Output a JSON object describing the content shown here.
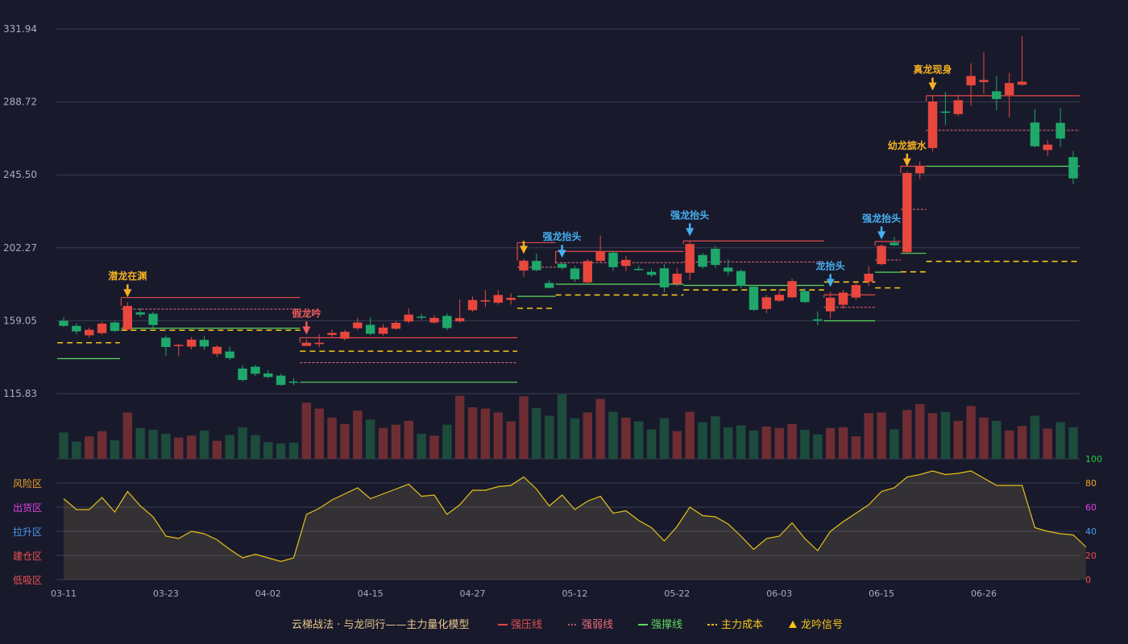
{
  "colors": {
    "up": "#e8473d",
    "down": "#1fa86a",
    "vol_up": "#6e2d33",
    "vol_down": "#1d4b3c",
    "pressure": "#e04848",
    "weak": "#f06a7a",
    "support": "#5fd85f",
    "cost": "#f5c518",
    "signal_yellow": "#f5b021",
    "signal_blue": "#45b0f0",
    "signal_red": "#f05a5a",
    "grid": "#3a3d52",
    "axis_text": "#a8acc0"
  },
  "legend": {
    "title": "云梯战法 · 与龙同行——主力量化模型",
    "pressure": "强压线",
    "weak": "强弱线",
    "support": "强撑线",
    "cost": "主力成本",
    "signal": "龙吟信号"
  },
  "zones": [
    {
      "label": "风险区",
      "color": "#f0a020"
    },
    {
      "label": "出货区",
      "color": "#e040e0"
    },
    {
      "label": "拉升区",
      "color": "#4a9af0"
    },
    {
      "label": "建仓区",
      "color": "#f05050"
    },
    {
      "label": "低吸区",
      "color": "#f05050"
    }
  ],
  "chart_data": {
    "type": "candlestick",
    "price_axis": {
      "ticks": [
        "331.94",
        "288.72",
        "245.50",
        "202.27",
        "159.05",
        "115.83"
      ]
    },
    "indicator_axis": {
      "ticks": [
        "100",
        "80",
        "60",
        "40",
        "20",
        "0"
      ],
      "tick_colors": [
        "#22cc44",
        "#f0a020",
        "#e040e0",
        "#4a9af0",
        "#f05050",
        "#f05050"
      ]
    },
    "date_labels": [
      {
        "i": 0,
        "label": "03-11"
      },
      {
        "i": 8,
        "label": "03-23"
      },
      {
        "i": 16,
        "label": "04-02"
      },
      {
        "i": 24,
        "label": "04-15"
      },
      {
        "i": 32,
        "label": "04-27"
      },
      {
        "i": 40,
        "label": "05-12"
      },
      {
        "i": 48,
        "label": "05-22"
      },
      {
        "i": 56,
        "label": "06-03"
      },
      {
        "i": 64,
        "label": "06-15"
      },
      {
        "i": 72,
        "label": "06-26"
      }
    ],
    "candles": [
      [
        159.0,
        156.0,
        161.2,
        155.3
      ],
      [
        156.0,
        152.7,
        157.5,
        151.0
      ],
      [
        150.4,
        153.7,
        155.0,
        148.9
      ],
      [
        151.7,
        157.3,
        158.5,
        150.6
      ],
      [
        158.0,
        153.0,
        158.8,
        152.3
      ],
      [
        153.8,
        167.8,
        170.1,
        153.1
      ],
      [
        164.0,
        162.7,
        166.6,
        161.2
      ],
      [
        163.2,
        156.5,
        164.3,
        154.8
      ],
      [
        149.0,
        143.5,
        150.4,
        138.3
      ],
      [
        144.3,
        144.7,
        145.5,
        137.9
      ],
      [
        143.7,
        147.8,
        149.3,
        142.0
      ],
      [
        147.7,
        143.8,
        150.0,
        141.8
      ],
      [
        139.4,
        143.6,
        144.6,
        137.6
      ],
      [
        140.8,
        136.9,
        143.7,
        135.7
      ],
      [
        130.7,
        123.9,
        132.8,
        123.1
      ],
      [
        131.8,
        127.6,
        132.8,
        126.4
      ],
      [
        127.8,
        125.7,
        129.8,
        125.0
      ],
      [
        126.5,
        121.0,
        127.6,
        120.6
      ],
      [
        123.0,
        122.3,
        125.0,
        121.0
      ],
      [
        144.1,
        146.0,
        148.0,
        144.7
      ],
      [
        145.2,
        146.0,
        151.0,
        143.4
      ],
      [
        150.6,
        151.8,
        153.7,
        149.3
      ],
      [
        148.4,
        152.5,
        153.5,
        147.4
      ],
      [
        154.6,
        158.0,
        160.7,
        153.5
      ],
      [
        156.6,
        151.3,
        161.0,
        150.5
      ],
      [
        151.3,
        155.0,
        157.0,
        150.3
      ],
      [
        154.3,
        157.8,
        158.9,
        153.7
      ],
      [
        158.6,
        162.7,
        166.3,
        157.6
      ],
      [
        161.5,
        160.8,
        163.2,
        159.6
      ],
      [
        158.0,
        160.7,
        162.3,
        157.3
      ],
      [
        161.9,
        154.7,
        163.4,
        153.4
      ],
      [
        158.7,
        160.6,
        171.7,
        158.0
      ],
      [
        165.3,
        171.3,
        173.4,
        164.4
      ],
      [
        170.4,
        171.2,
        177.3,
        167.1
      ],
      [
        169.7,
        174.3,
        177.2,
        168.6
      ],
      [
        171.4,
        172.6,
        175.3,
        168.6
      ],
      [
        188.8,
        194.6,
        195.8,
        185.1
      ],
      [
        194.5,
        189.0,
        198.8,
        188.4
      ],
      [
        181.4,
        178.5,
        183.0,
        178.3
      ],
      [
        192.8,
        190.4,
        193.5,
        189.4
      ],
      [
        190.0,
        183.6,
        191.5,
        182.1
      ],
      [
        181.8,
        194.4,
        195.6,
        180.7
      ],
      [
        194.5,
        200.3,
        209.5,
        193.3
      ],
      [
        199.4,
        190.8,
        200.4,
        188.6
      ],
      [
        191.5,
        195.1,
        197.5,
        188.5
      ],
      [
        189.8,
        189.7,
        191.6,
        188.8
      ],
      [
        188.0,
        186.2,
        189.7,
        185.0
      ],
      [
        190.1,
        178.8,
        192.5,
        176.0
      ],
      [
        180.9,
        186.9,
        190.0,
        179.4
      ],
      [
        187.5,
        204.5,
        206.3,
        183.0
      ],
      [
        198.0,
        191.0,
        199.3,
        189.8
      ],
      [
        201.7,
        192.1,
        203.2,
        190.4
      ],
      [
        190.5,
        188.2,
        195.4,
        186.0
      ],
      [
        188.5,
        179.7,
        189.5,
        178.3
      ],
      [
        179.2,
        165.5,
        180.2,
        164.8
      ],
      [
        166.0,
        172.9,
        174.2,
        163.5
      ],
      [
        170.9,
        174.4,
        177.9,
        170.2
      ],
      [
        172.9,
        182.5,
        184.0,
        172.5
      ],
      [
        176.6,
        170.1,
        178.2,
        169.6
      ],
      [
        159.9,
        159.0,
        164.6,
        156.5
      ],
      [
        164.6,
        172.7,
        176.2,
        160.3
      ],
      [
        168.5,
        175.7,
        177.4,
        166.1
      ],
      [
        172.8,
        180.2,
        181.9,
        171.3
      ],
      [
        182.2,
        186.9,
        191.4,
        179.7
      ],
      [
        192.6,
        203.4,
        204.4,
        191.8
      ],
      [
        205.3,
        203.8,
        208.8,
        203.3
      ],
      [
        199.7,
        246.6,
        247.6,
        199.2
      ],
      [
        246.4,
        250.6,
        253.4,
        243.0
      ],
      [
        261.4,
        289.0,
        292.6,
        259.4
      ],
      [
        283.0,
        282.9,
        294.6,
        275.0
      ],
      [
        281.5,
        289.7,
        293.0,
        280.2
      ],
      [
        298.5,
        304.1,
        311.6,
        286.3
      ],
      [
        300.5,
        301.7,
        318.0,
        293.6
      ],
      [
        295.0,
        290.4,
        304.0,
        283.7
      ],
      [
        292.8,
        299.9,
        306.0,
        279.5
      ],
      [
        298.9,
        300.7,
        327.5,
        298.4
      ],
      [
        276.5,
        262.4,
        284.5,
        261.8
      ],
      [
        260.2,
        263.4,
        265.9,
        256.8
      ],
      [
        276.3,
        267.0,
        285.1,
        262.1
      ],
      [
        256.0,
        243.4,
        259.5,
        240.0
      ]
    ],
    "volumes": [
      0.41,
      0.27,
      0.35,
      0.43,
      0.29,
      0.72,
      0.48,
      0.45,
      0.39,
      0.33,
      0.36,
      0.44,
      0.28,
      0.37,
      0.49,
      0.37,
      0.26,
      0.24,
      0.25,
      0.87,
      0.78,
      0.64,
      0.54,
      0.75,
      0.61,
      0.48,
      0.53,
      0.59,
      0.39,
      0.36,
      0.53,
      0.98,
      0.8,
      0.78,
      0.72,
      0.58,
      0.97,
      0.79,
      0.67,
      1.0,
      0.63,
      0.72,
      0.93,
      0.73,
      0.64,
      0.58,
      0.46,
      0.63,
      0.43,
      0.73,
      0.57,
      0.66,
      0.49,
      0.52,
      0.44,
      0.5,
      0.48,
      0.54,
      0.45,
      0.38,
      0.48,
      0.49,
      0.35,
      0.71,
      0.72,
      0.46,
      0.76,
      0.85,
      0.71,
      0.73,
      0.59,
      0.82,
      0.64,
      0.59,
      0.44,
      0.51,
      0.67,
      0.47,
      0.57,
      0.49
    ],
    "indicator": [
      67,
      58,
      58,
      68,
      56,
      73,
      61,
      52,
      36,
      34,
      40,
      38,
      33,
      25,
      18,
      21,
      18,
      15,
      18,
      54,
      59,
      66,
      71,
      76,
      67,
      71,
      75,
      79,
      69,
      70,
      54,
      62,
      74,
      74,
      77,
      78,
      85,
      75,
      61,
      70,
      58,
      65,
      69,
      55,
      57,
      49,
      43,
      32,
      44,
      60,
      53,
      52,
      46,
      36,
      25,
      34,
      36,
      47,
      34,
      24,
      40,
      48,
      55,
      62,
      73,
      76,
      85,
      87,
      90,
      87,
      88,
      90,
      84,
      78,
      78,
      78,
      43,
      40,
      38,
      37,
      27
    ],
    "levels": [
      {
        "kind": "cost",
        "y": 146.0,
        "i0": 0,
        "i1": 3.9
      },
      {
        "kind": "support",
        "y": 136.6,
        "i0": 0,
        "i1": 3.9
      },
      {
        "kind": "pressure",
        "y": 172.8,
        "i0": 5,
        "i1": 18
      },
      {
        "kind": "weak",
        "y": 165.9,
        "i0": 5,
        "i1": 18
      },
      {
        "kind": "support",
        "y": 154.6,
        "i0": 5,
        "i1": 18
      },
      {
        "kind": "cost",
        "y": 153.4,
        "i0": 5,
        "i1": 18
      },
      {
        "kind": "pressure",
        "y": 149.0,
        "i0": 19,
        "i1": 35
      },
      {
        "kind": "cost",
        "y": 141.0,
        "i0": 19,
        "i1": 35
      },
      {
        "kind": "weak",
        "y": 134.2,
        "i0": 19,
        "i1": 35
      },
      {
        "kind": "support",
        "y": 122.6,
        "i0": 19,
        "i1": 35
      },
      {
        "kind": "pressure",
        "y": 205.3,
        "i0": 36,
        "i1": 38
      },
      {
        "kind": "weak",
        "y": 190.8,
        "i0": 36,
        "i1": 38
      },
      {
        "kind": "support",
        "y": 173.5,
        "i0": 36,
        "i1": 38
      },
      {
        "kind": "cost",
        "y": 166.4,
        "i0": 36,
        "i1": 38
      },
      {
        "kind": "pressure",
        "y": 200.1,
        "i0": 39,
        "i1": 48
      },
      {
        "kind": "weak",
        "y": 193.5,
        "i0": 39,
        "i1": 48
      },
      {
        "kind": "support",
        "y": 180.7,
        "i0": 39,
        "i1": 48
      },
      {
        "kind": "cost",
        "y": 174.3,
        "i0": 39,
        "i1": 48
      },
      {
        "kind": "pressure",
        "y": 206.3,
        "i0": 49,
        "i1": 59
      },
      {
        "kind": "weak",
        "y": 193.9,
        "i0": 49,
        "i1": 59
      },
      {
        "kind": "support",
        "y": 180.0,
        "i0": 49,
        "i1": 59
      },
      {
        "kind": "cost",
        "y": 177.3,
        "i0": 49,
        "i1": 59
      },
      {
        "kind": "pressure",
        "y": 174.4,
        "i0": 60,
        "i1": 63
      },
      {
        "kind": "weak",
        "y": 167.0,
        "i0": 60,
        "i1": 63
      },
      {
        "kind": "support",
        "y": 159.0,
        "i0": 60,
        "i1": 63
      },
      {
        "kind": "cost",
        "y": 182.0,
        "i0": 60,
        "i1": 63
      },
      {
        "kind": "pressure",
        "y": 206.0,
        "i0": 64,
        "i1": 65
      },
      {
        "kind": "weak",
        "y": 195.0,
        "i0": 64,
        "i1": 65
      },
      {
        "kind": "support",
        "y": 187.8,
        "i0": 64,
        "i1": 65
      },
      {
        "kind": "cost",
        "y": 178.5,
        "i0": 64,
        "i1": 65
      },
      {
        "kind": "pressure",
        "y": 250.6,
        "i0": 66,
        "i1": 67
      },
      {
        "kind": "weak",
        "y": 225.0,
        "i0": 66,
        "i1": 67
      },
      {
        "kind": "support",
        "y": 199.0,
        "i0": 66,
        "i1": 67
      },
      {
        "kind": "cost",
        "y": 188.0,
        "i0": 66,
        "i1": 67
      },
      {
        "kind": "pressure",
        "y": 292.4,
        "i0": 68,
        "i1": 79.5
      },
      {
        "kind": "weak",
        "y": 271.9,
        "i0": 68,
        "i1": 79.5
      },
      {
        "kind": "support",
        "y": 250.6,
        "i0": 68,
        "i1": 79.5
      },
      {
        "kind": "cost",
        "y": 194.2,
        "i0": 68,
        "i1": 79.5
      }
    ],
    "signals": [
      {
        "i": 5,
        "text": "潜龙在渊",
        "color": "yellow",
        "dir": "down",
        "at": "above"
      },
      {
        "i": 19,
        "text": "假龙吟",
        "color": "red",
        "dir": "down",
        "at": "above"
      },
      {
        "i": 36,
        "text": "",
        "color": "yellow",
        "dir": "down",
        "at": "above"
      },
      {
        "i": 39,
        "text": "强龙抬头",
        "color": "blue",
        "dir": "down",
        "at": "above"
      },
      {
        "i": 49,
        "text": "强龙抬头",
        "color": "blue",
        "dir": "down",
        "at": "above"
      },
      {
        "i": 60,
        "text": "龙抬头",
        "color": "blue",
        "dir": "down",
        "at": "above"
      },
      {
        "i": 64,
        "text": "强龙抬头",
        "color": "blue",
        "dir": "down",
        "at": "above"
      },
      {
        "i": 66,
        "text": "幼龙摭水",
        "color": "yellow",
        "dir": "down",
        "at": "above"
      },
      {
        "i": 68,
        "text": "真龙现身",
        "color": "yellow",
        "dir": "down",
        "at": "above"
      }
    ]
  }
}
